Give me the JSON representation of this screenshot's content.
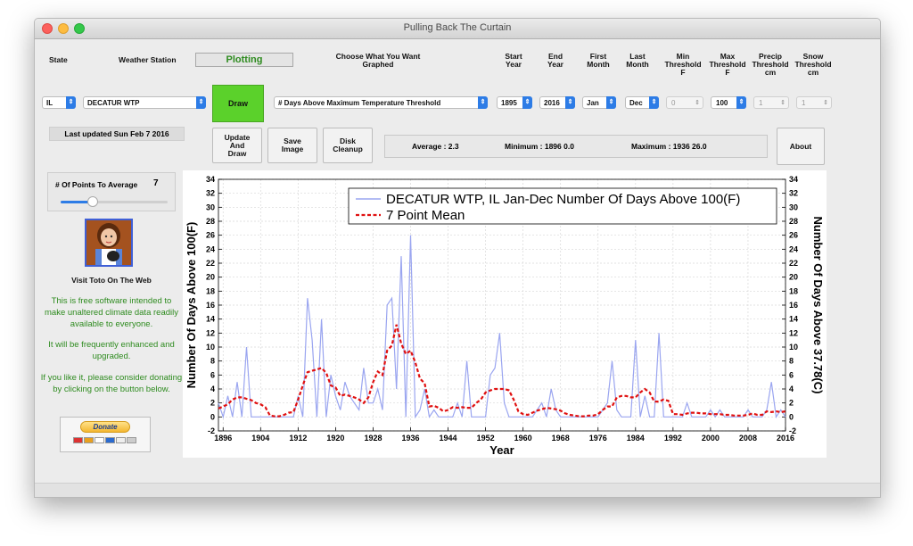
{
  "window": {
    "title": "Pulling Back The Curtain"
  },
  "headers": {
    "state": "State",
    "station": "Weather Station",
    "graph_line1": "Choose What You Want",
    "graph_line2": "Graphed",
    "start1": "Start",
    "start2": "Year",
    "end1": "End",
    "end2": "Year",
    "fm1": "First",
    "fm2": "Month",
    "lm1": "Last",
    "lm2": "Month",
    "min1": "Min",
    "min2": "Threshold",
    "min3": "F",
    "max1": "Max",
    "max2": "Threshold",
    "max3": "F",
    "pr1": "Precip",
    "pr2": "Threshold",
    "pr3": "cm",
    "sn1": "Snow",
    "sn2": "Threshold",
    "sn3": "cm"
  },
  "status": {
    "plotting": "Plotting"
  },
  "controls": {
    "state": "IL",
    "station": "DECATUR WTP",
    "graph_type": "# Days Above Maximum Temperature Threshold",
    "start_year": "1895",
    "end_year": "2016",
    "first_month": "Jan",
    "last_month": "Dec",
    "min_threshold": "0",
    "max_threshold": "100",
    "precip_threshold": "1",
    "snow_threshold": "1"
  },
  "buttons": {
    "draw": "Draw",
    "update_draw": "Update\nAnd\nDraw",
    "save_image": "Save\nImage",
    "disk_cleanup": "Disk\nCleanup",
    "about": "About",
    "donate": "Donate"
  },
  "last_updated": "Last updated Sun Feb 7 2016",
  "stats": {
    "average": "Average : 2.3",
    "minimum": "Minimum : 1896  0.0",
    "maximum": "Maximum : 1936  26.0"
  },
  "averaging": {
    "label": "# Of Points To Average",
    "value": "7",
    "fraction": 0.3
  },
  "sidebar": {
    "visit": "Visit Toto On The Web",
    "p1": "This is free software intended to make unaltered climate data readily available to everyone.",
    "p2": "It will be frequently enhanced and upgraded.",
    "p3": "If you like it, please consider donating by clicking on the button below."
  },
  "colors": {
    "raw": "#9aa5f0",
    "mean": "#e01010",
    "draw": "#5bd12b",
    "sidebar_text": "#2e8b1f"
  },
  "chart_data": {
    "type": "line",
    "xlabel": "Year",
    "ylabel": "Number Of Days Above 100(F)",
    "ylabel_right": "Number Of Days Above 37.78(C)",
    "xlim": [
      1895,
      2016
    ],
    "ylim": [
      -2,
      34
    ],
    "xticks": [
      1896,
      1904,
      1912,
      1920,
      1928,
      1936,
      1944,
      1952,
      1960,
      1968,
      1976,
      1984,
      1992,
      2000,
      2008,
      2016
    ],
    "yticks": [
      -2,
      0,
      2,
      4,
      6,
      8,
      10,
      12,
      14,
      16,
      18,
      20,
      22,
      24,
      26,
      28,
      30,
      32,
      34
    ],
    "grid": true,
    "legend_position": "top-right",
    "series": [
      {
        "name": "DECATUR WTP, IL  Jan-Dec  Number Of Days Above 100(F)",
        "style": "solid",
        "x": [
          1895,
          1896,
          1897,
          1898,
          1899,
          1900,
          1901,
          1902,
          1903,
          1904,
          1905,
          1906,
          1907,
          1908,
          1909,
          1910,
          1911,
          1912,
          1913,
          1914,
          1915,
          1916,
          1917,
          1918,
          1919,
          1920,
          1921,
          1922,
          1923,
          1924,
          1925,
          1926,
          1927,
          1928,
          1929,
          1930,
          1931,
          1932,
          1933,
          1934,
          1935,
          1936,
          1937,
          1938,
          1939,
          1940,
          1941,
          1942,
          1943,
          1944,
          1945,
          1946,
          1947,
          1948,
          1949,
          1950,
          1951,
          1952,
          1953,
          1954,
          1955,
          1956,
          1957,
          1958,
          1959,
          1960,
          1961,
          1962,
          1963,
          1964,
          1965,
          1966,
          1967,
          1968,
          1969,
          1970,
          1971,
          1972,
          1973,
          1974,
          1975,
          1976,
          1977,
          1978,
          1979,
          1980,
          1981,
          1982,
          1983,
          1984,
          1985,
          1986,
          1987,
          1988,
          1989,
          1990,
          1991,
          1992,
          1993,
          1994,
          1995,
          1996,
          1997,
          1998,
          1999,
          2000,
          2001,
          2002,
          2003,
          2004,
          2005,
          2006,
          2007,
          2008,
          2009,
          2010,
          2011,
          2012,
          2013,
          2014,
          2015,
          2016
        ],
        "values": [
          2,
          0,
          3,
          0,
          5,
          0,
          10,
          0,
          0,
          0,
          0,
          0,
          0,
          0,
          0,
          0,
          0,
          3,
          0,
          17,
          11,
          0,
          14,
          0,
          6,
          3,
          1,
          5,
          3,
          2,
          1,
          7,
          2,
          2,
          4,
          1,
          16,
          17,
          4,
          23,
          0,
          26,
          0,
          1,
          4,
          0,
          1,
          0,
          0,
          0,
          0,
          2,
          0,
          8,
          0,
          0,
          0,
          0,
          6,
          7,
          12,
          2,
          0,
          0,
          0,
          0,
          0,
          0,
          1,
          2,
          0,
          4,
          1,
          0,
          0,
          0,
          0,
          0,
          0,
          0,
          0,
          0,
          1,
          2,
          8,
          1,
          0,
          0,
          0,
          11,
          0,
          3,
          0,
          0,
          12,
          0,
          0,
          0,
          0,
          0,
          2,
          0,
          0,
          0,
          0,
          1,
          0,
          1,
          0,
          0,
          0,
          0,
          0,
          1,
          0,
          0,
          0,
          1,
          5,
          0,
          1,
          0
        ],
        "color": "#9aa5f0"
      },
      {
        "name": "7 Point Mean",
        "style": "dashed",
        "x": [
          1895,
          1896,
          1897,
          1898,
          1899,
          1900,
          1901,
          1902,
          1903,
          1904,
          1905,
          1906,
          1907,
          1908,
          1909,
          1910,
          1911,
          1912,
          1913,
          1914,
          1915,
          1916,
          1917,
          1918,
          1919,
          1920,
          1921,
          1922,
          1923,
          1924,
          1925,
          1926,
          1927,
          1928,
          1929,
          1930,
          1931,
          1932,
          1933,
          1934,
          1935,
          1936,
          1937,
          1938,
          1939,
          1940,
          1941,
          1942,
          1943,
          1944,
          1945,
          1946,
          1947,
          1948,
          1949,
          1950,
          1951,
          1952,
          1953,
          1954,
          1955,
          1956,
          1957,
          1958,
          1959,
          1960,
          1961,
          1962,
          1963,
          1964,
          1965,
          1966,
          1967,
          1968,
          1969,
          1970,
          1971,
          1972,
          1973,
          1974,
          1975,
          1976,
          1977,
          1978,
          1979,
          1980,
          1981,
          1982,
          1983,
          1984,
          1985,
          1986,
          1987,
          1988,
          1989,
          1990,
          1991,
          1992,
          1993,
          1994,
          1995,
          1996,
          1997,
          1998,
          1999,
          2000,
          2001,
          2002,
          2003,
          2004,
          2005,
          2006,
          2007,
          2008,
          2009,
          2010,
          2011,
          2012,
          2013,
          2014,
          2015,
          2016
        ],
        "values": [
          1.2,
          1.5,
          1.8,
          2.5,
          2.8,
          2.8,
          2.6,
          2.4,
          2.0,
          1.8,
          1.4,
          0.2,
          0.1,
          0.1,
          0.3,
          0.6,
          0.7,
          2.5,
          4.5,
          6.4,
          6.6,
          6.8,
          7.0,
          6.3,
          4.5,
          4.2,
          3.0,
          3.2,
          3.0,
          2.8,
          2.5,
          2.0,
          2.8,
          5.0,
          6.5,
          6.0,
          9.5,
          10.2,
          13.2,
          10.5,
          9.0,
          9.5,
          7.8,
          5.5,
          4.8,
          1.5,
          1.6,
          1.3,
          0.8,
          1.0,
          1.4,
          1.3,
          1.4,
          1.3,
          1.3,
          2.0,
          2.5,
          3.5,
          3.8,
          4.0,
          4.0,
          4.0,
          3.8,
          2.5,
          0.8,
          0.4,
          0.3,
          0.6,
          0.9,
          1.1,
          1.3,
          1.2,
          1.1,
          0.9,
          0.5,
          0.3,
          0.2,
          0.1,
          0.1,
          0.2,
          0.2,
          0.4,
          1.0,
          1.5,
          1.5,
          2.8,
          3.0,
          3.0,
          2.8,
          2.8,
          3.5,
          4.0,
          3.5,
          2.2,
          2.2,
          2.5,
          2.3,
          0.4,
          0.4,
          0.3,
          0.5,
          0.6,
          0.6,
          0.5,
          0.5,
          0.4,
          0.4,
          0.4,
          0.3,
          0.3,
          0.2,
          0.2,
          0.2,
          0.3,
          0.5,
          0.3,
          0.3,
          0.8,
          0.7,
          0.8,
          0.7,
          0.8
        ]
      }
    ]
  }
}
